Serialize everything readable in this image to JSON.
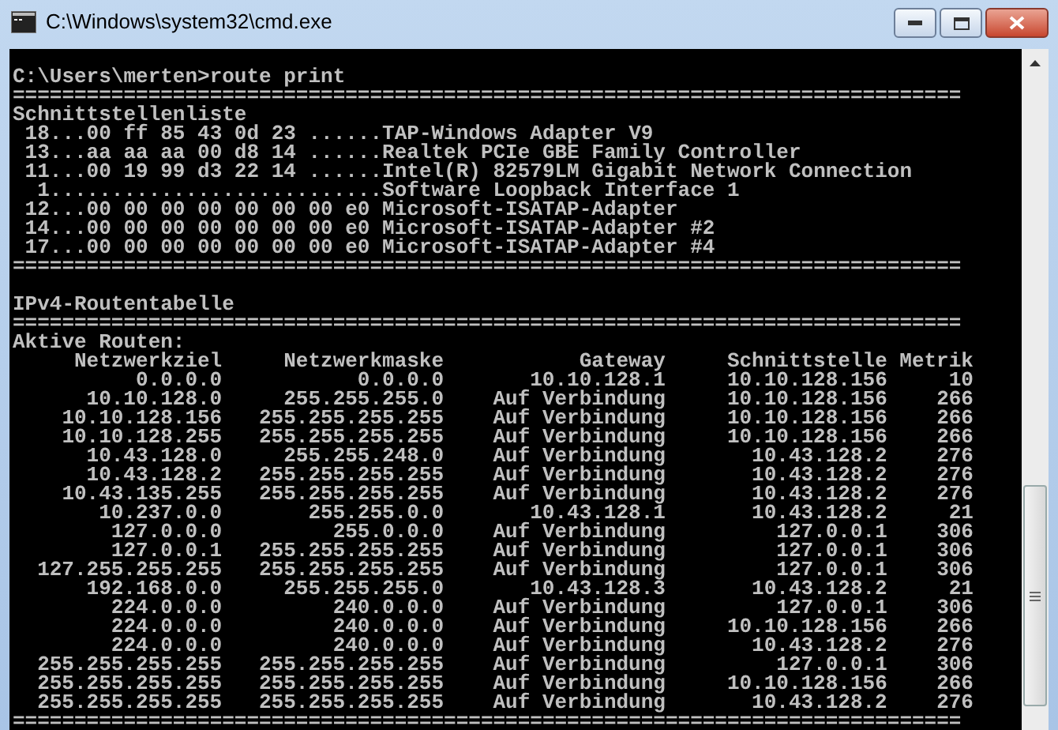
{
  "window": {
    "title": "C:\\Windows\\system32\\cmd.exe"
  },
  "console": {
    "lines": [
      {
        "kind": "blank"
      },
      {
        "kind": "text",
        "text": "C:\\Users\\merten>route print"
      },
      {
        "kind": "rule",
        "text": "============================================================================="
      },
      {
        "kind": "text",
        "text": "Schnittstellenliste"
      },
      {
        "kind": "text",
        "text": " 18...00 ff 85 43 0d 23 ......TAP-Windows Adapter V9"
      },
      {
        "kind": "text",
        "text": " 13...aa aa aa 00 d8 14 ......Realtek PCIe GBE Family Controller"
      },
      {
        "kind": "text",
        "text": " 11...00 19 99 d3 22 14 ......Intel(R) 82579LM Gigabit Network Connection"
      },
      {
        "kind": "text",
        "text": "  1...........................Software Loopback Interface 1"
      },
      {
        "kind": "text",
        "text": " 12...00 00 00 00 00 00 00 e0 Microsoft-ISATAP-Adapter"
      },
      {
        "kind": "text",
        "text": " 14...00 00 00 00 00 00 00 e0 Microsoft-ISATAP-Adapter #2"
      },
      {
        "kind": "text",
        "text": " 17...00 00 00 00 00 00 00 e0 Microsoft-ISATAP-Adapter #4"
      },
      {
        "kind": "rule",
        "text": "============================================================================="
      },
      {
        "kind": "blank"
      },
      {
        "kind": "text",
        "text": "IPv4-Routentabelle"
      },
      {
        "kind": "rule",
        "text": "============================================================================="
      },
      {
        "kind": "text",
        "text": "Aktive Routen:"
      },
      {
        "kind": "header",
        "cells": [
          "Netzwerkziel",
          "Netzwerkmaske",
          "Gateway",
          "Schnittstelle",
          "Metrik"
        ]
      },
      {
        "kind": "route",
        "cells": [
          "0.0.0.0",
          "0.0.0.0",
          "10.10.128.1",
          "10.10.128.156",
          "10"
        ]
      },
      {
        "kind": "route",
        "cells": [
          "10.10.128.0",
          "255.255.255.0",
          "Auf Verbindung",
          "10.10.128.156",
          "266"
        ]
      },
      {
        "kind": "route",
        "cells": [
          "10.10.128.156",
          "255.255.255.255",
          "Auf Verbindung",
          "10.10.128.156",
          "266"
        ]
      },
      {
        "kind": "route",
        "cells": [
          "10.10.128.255",
          "255.255.255.255",
          "Auf Verbindung",
          "10.10.128.156",
          "266"
        ]
      },
      {
        "kind": "route",
        "cells": [
          "10.43.128.0",
          "255.255.248.0",
          "Auf Verbindung",
          "10.43.128.2",
          "276"
        ]
      },
      {
        "kind": "route",
        "cells": [
          "10.43.128.2",
          "255.255.255.255",
          "Auf Verbindung",
          "10.43.128.2",
          "276"
        ]
      },
      {
        "kind": "route",
        "cells": [
          "10.43.135.255",
          "255.255.255.255",
          "Auf Verbindung",
          "10.43.128.2",
          "276"
        ]
      },
      {
        "kind": "route",
        "cells": [
          "10.237.0.0",
          "255.255.0.0",
          "10.43.128.1",
          "10.43.128.2",
          "21"
        ]
      },
      {
        "kind": "route",
        "cells": [
          "127.0.0.0",
          "255.0.0.0",
          "Auf Verbindung",
          "127.0.0.1",
          "306"
        ]
      },
      {
        "kind": "route",
        "cells": [
          "127.0.0.1",
          "255.255.255.255",
          "Auf Verbindung",
          "127.0.0.1",
          "306"
        ]
      },
      {
        "kind": "route",
        "cells": [
          "127.255.255.255",
          "255.255.255.255",
          "Auf Verbindung",
          "127.0.0.1",
          "306"
        ]
      },
      {
        "kind": "route",
        "cells": [
          "192.168.0.0",
          "255.255.255.0",
          "10.43.128.3",
          "10.43.128.2",
          "21"
        ]
      },
      {
        "kind": "route",
        "cells": [
          "224.0.0.0",
          "240.0.0.0",
          "Auf Verbindung",
          "127.0.0.1",
          "306"
        ]
      },
      {
        "kind": "route",
        "cells": [
          "224.0.0.0",
          "240.0.0.0",
          "Auf Verbindung",
          "10.10.128.156",
          "266"
        ]
      },
      {
        "kind": "route",
        "cells": [
          "224.0.0.0",
          "240.0.0.0",
          "Auf Verbindung",
          "10.43.128.2",
          "276"
        ]
      },
      {
        "kind": "route",
        "cells": [
          "255.255.255.255",
          "255.255.255.255",
          "Auf Verbindung",
          "127.0.0.1",
          "306"
        ]
      },
      {
        "kind": "route",
        "cells": [
          "255.255.255.255",
          "255.255.255.255",
          "Auf Verbindung",
          "10.10.128.156",
          "266"
        ]
      },
      {
        "kind": "route",
        "cells": [
          "255.255.255.255",
          "255.255.255.255",
          "Auf Verbindung",
          "10.43.128.2",
          "276"
        ]
      },
      {
        "kind": "rule",
        "text": "============================================================================="
      }
    ]
  }
}
